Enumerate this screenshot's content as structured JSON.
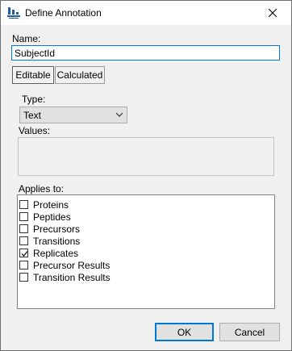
{
  "window": {
    "title": "Define Annotation"
  },
  "form": {
    "name_label": "Name:",
    "name_value": "SubjectId",
    "tabs": [
      {
        "label": "Editable",
        "selected": true
      },
      {
        "label": "Calculated",
        "selected": false
      }
    ],
    "type_label": "Type:",
    "type_value": "Text",
    "values_label": "Values:",
    "applies_label": "Applies to:",
    "applies_items": [
      {
        "label": "Proteins",
        "checked": false
      },
      {
        "label": "Peptides",
        "checked": false
      },
      {
        "label": "Precursors",
        "checked": false
      },
      {
        "label": "Transitions",
        "checked": false
      },
      {
        "label": "Replicates",
        "checked": true
      },
      {
        "label": "Precursor Results",
        "checked": false
      },
      {
        "label": "Transition Results",
        "checked": false
      }
    ]
  },
  "buttons": {
    "ok": "OK",
    "cancel": "Cancel"
  },
  "icons": {
    "app": "annotation-app-icon",
    "close": "close-icon",
    "dropdown": "chevron-down-icon",
    "check": "checkmark-icon"
  },
  "colors": {
    "focus_accent": "#0078d7"
  }
}
